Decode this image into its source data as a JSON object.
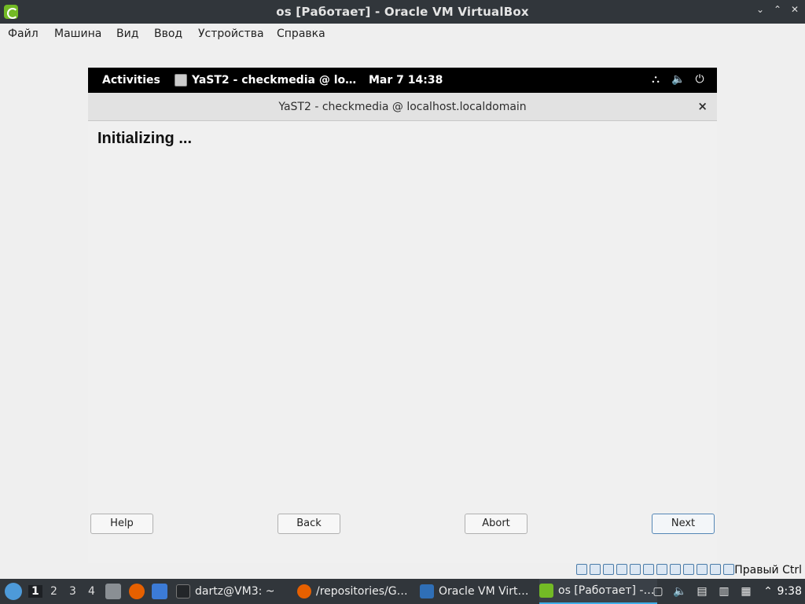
{
  "window": {
    "title": "os [Работает] - Oracle VM VirtualBox",
    "buttons": {
      "minimize": "⌄",
      "maximize": "⌃",
      "close": "✕"
    }
  },
  "menubar": {
    "items": [
      "Файл",
      "Машина",
      "Вид",
      "Ввод",
      "Устройства",
      "Справка"
    ]
  },
  "guest": {
    "topbar": {
      "activities": "Activities",
      "app_title": "YaST2 - checkmedia @ lo…",
      "clock": "Mar 7  14:38"
    },
    "yast": {
      "window_title": "YaST2 - checkmedia @ localhost.localdomain",
      "close_label": "×",
      "heading": "Initializing ...",
      "buttons": {
        "help": "Help",
        "back": "Back",
        "abort": "Abort",
        "next": "Next"
      }
    }
  },
  "statusbar": {
    "host_key": "Правый Ctrl"
  },
  "taskbar": {
    "workspaces": [
      "1",
      "2",
      "3",
      "4"
    ],
    "active_workspace": "1",
    "tasks": [
      {
        "label": "dartz@VM3: ~",
        "icon": "terminal-icon"
      },
      {
        "label": "/repositories/G…",
        "icon": "firefox-icon"
      },
      {
        "label": "Oracle VM Virt…",
        "icon": "virtualbox-icon"
      },
      {
        "label": "os [Работает] -…",
        "icon": "vm-icon"
      }
    ],
    "clock": "9:38"
  },
  "colors": {
    "titlebar": "#31363b",
    "accent": "#3daee9",
    "opensuse_green": "#73ba25"
  }
}
